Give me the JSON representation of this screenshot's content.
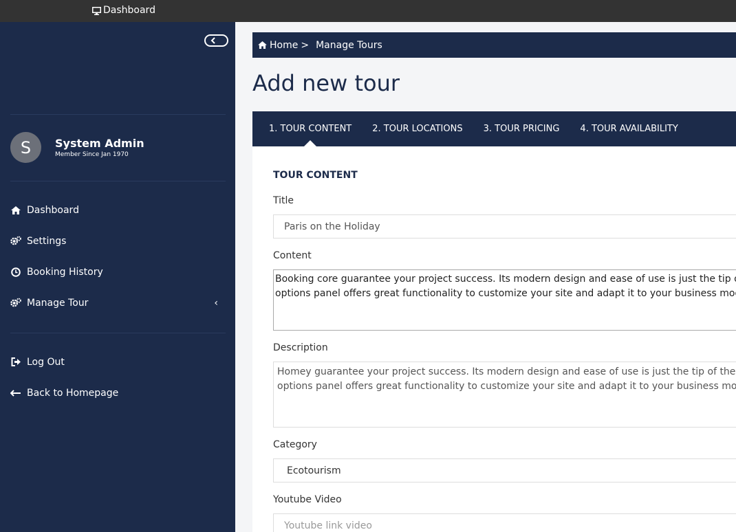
{
  "topbar": {
    "dashboard_label": "Dashboard"
  },
  "sidebar": {
    "user": {
      "initial": "S",
      "name": "System Admin",
      "member_since": "Member Since Jan 1970"
    },
    "menu": [
      {
        "label": "Dashboard",
        "icon": "home-icon"
      },
      {
        "label": "Settings",
        "icon": "gears-icon"
      },
      {
        "label": "Booking History",
        "icon": "clock-icon"
      },
      {
        "label": "Manage Tour",
        "icon": "gears-icon",
        "caret": "‹"
      }
    ],
    "footer_menu": [
      {
        "label": "Log Out",
        "icon": "sign-out-icon"
      },
      {
        "label": "Back to Homepage",
        "icon": "arrow-left-icon"
      }
    ]
  },
  "breadcrumb": {
    "home": "Home",
    "separator": ">",
    "current": "Manage Tours"
  },
  "page": {
    "title": "Add new tour"
  },
  "tabs": [
    {
      "label": "1. TOUR CONTENT",
      "active": true
    },
    {
      "label": "2. TOUR LOCATIONS",
      "active": false
    },
    {
      "label": "3. TOUR PRICING",
      "active": false
    },
    {
      "label": "4. TOUR AVAILABILITY",
      "active": false
    }
  ],
  "form": {
    "section_title": "TOUR CONTENT",
    "title_label": "Title",
    "title_value": "Paris on the Holiday",
    "content_label": "Content",
    "content_lines": [
      "Booking core guarantee your project success. Its modern design and ease of use is just the tip of",
      "options panel offers great functionality to customize your site and adapt it to your business mod"
    ],
    "description_label": "Description",
    "description_lines": [
      "Homey guarantee your project success. Its modern design and ease of use is just the tip of the ic",
      "options panel offers great functionality to customize your site and adapt it to your business moc"
    ],
    "category_label": "Category",
    "category_value": "Ecotourism",
    "youtube_label": "Youtube Video",
    "youtube_placeholder": "Youtube link video"
  },
  "colors": {
    "navy": "#1c2b4a",
    "topbar": "#333333",
    "avatar": "#6c7079",
    "background": "#f4f5f7"
  }
}
